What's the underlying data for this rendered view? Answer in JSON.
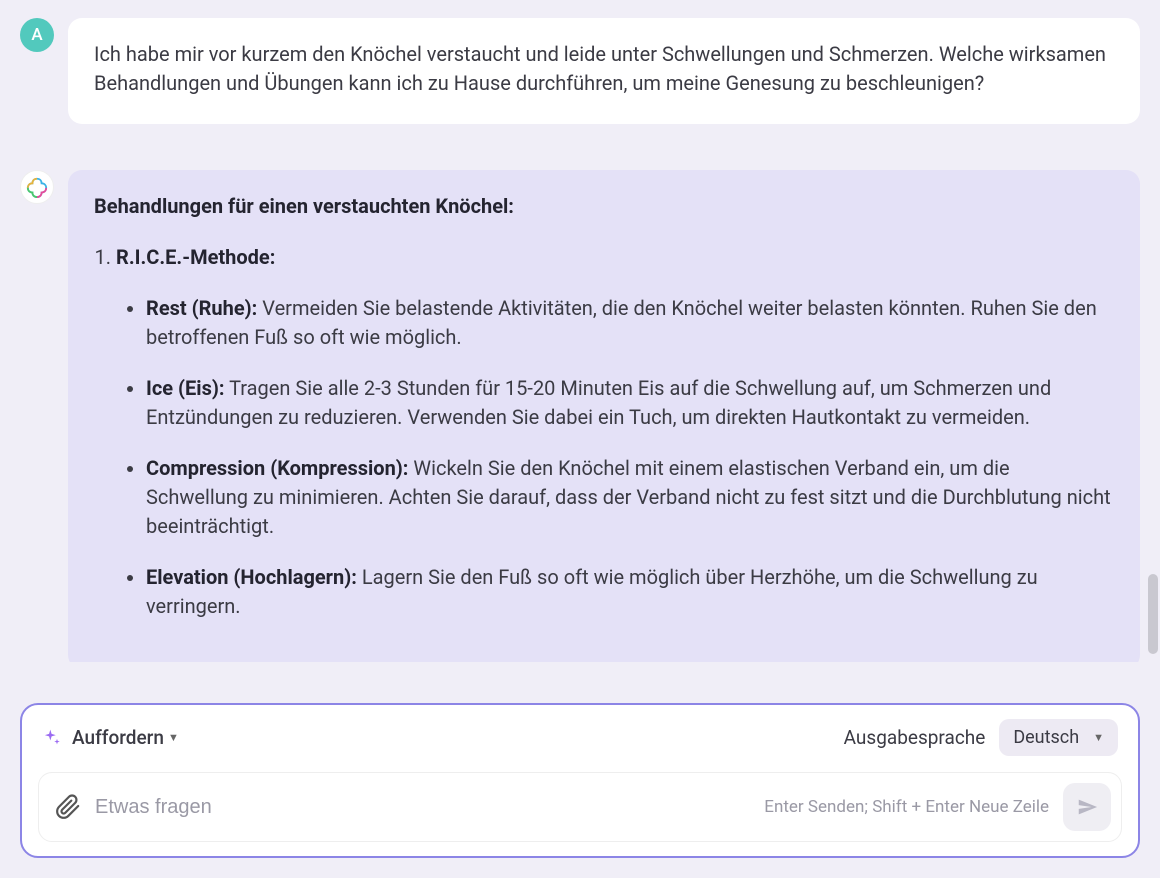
{
  "user_message": {
    "avatar_letter": "A",
    "text": "Ich habe mir vor kurzem den Knöchel verstaucht und leide unter Schwellungen und Schmerzen. Welche wirksamen Behandlungen und Übungen kann ich zu Hause durchführen, um meine Genesung zu beschleunigen?"
  },
  "assistant_message": {
    "heading": "Behandlungen für einen verstauchten Knöchel:",
    "list": [
      {
        "title": "R.I.C.E.-Methode:",
        "items": [
          {
            "term": "Rest (Ruhe):",
            "text": " Vermeiden Sie belastende Aktivitäten, die den Knöchel weiter belasten könnten. Ruhen Sie den betroffenen Fuß so oft wie möglich."
          },
          {
            "term": "Ice (Eis):",
            "text": " Tragen Sie alle 2-3 Stunden für 15-20 Minuten Eis auf die Schwellung auf, um Schmerzen und Entzündungen zu reduzieren. Verwenden Sie dabei ein Tuch, um direkten Hautkontakt zu vermeiden."
          },
          {
            "term": "Compression (Kompression):",
            "text": " Wickeln Sie den Knöchel mit einem elastischen Verband ein, um die Schwellung zu minimieren. Achten Sie darauf, dass der Verband nicht zu fest sitzt und die Durchblutung nicht beeinträchtigt."
          },
          {
            "term": "Elevation (Hochlagern):",
            "text": " Lagern Sie den Fuß so oft wie möglich über Herzhöhe, um die Schwellung zu verringern."
          }
        ]
      }
    ]
  },
  "composer": {
    "mode_label": "Auffordern",
    "output_lang_label": "Ausgabesprache",
    "lang_value": "Deutsch",
    "placeholder": "Etwas fragen",
    "hint": "Enter Senden; Shift + Enter Neue Zeile"
  }
}
